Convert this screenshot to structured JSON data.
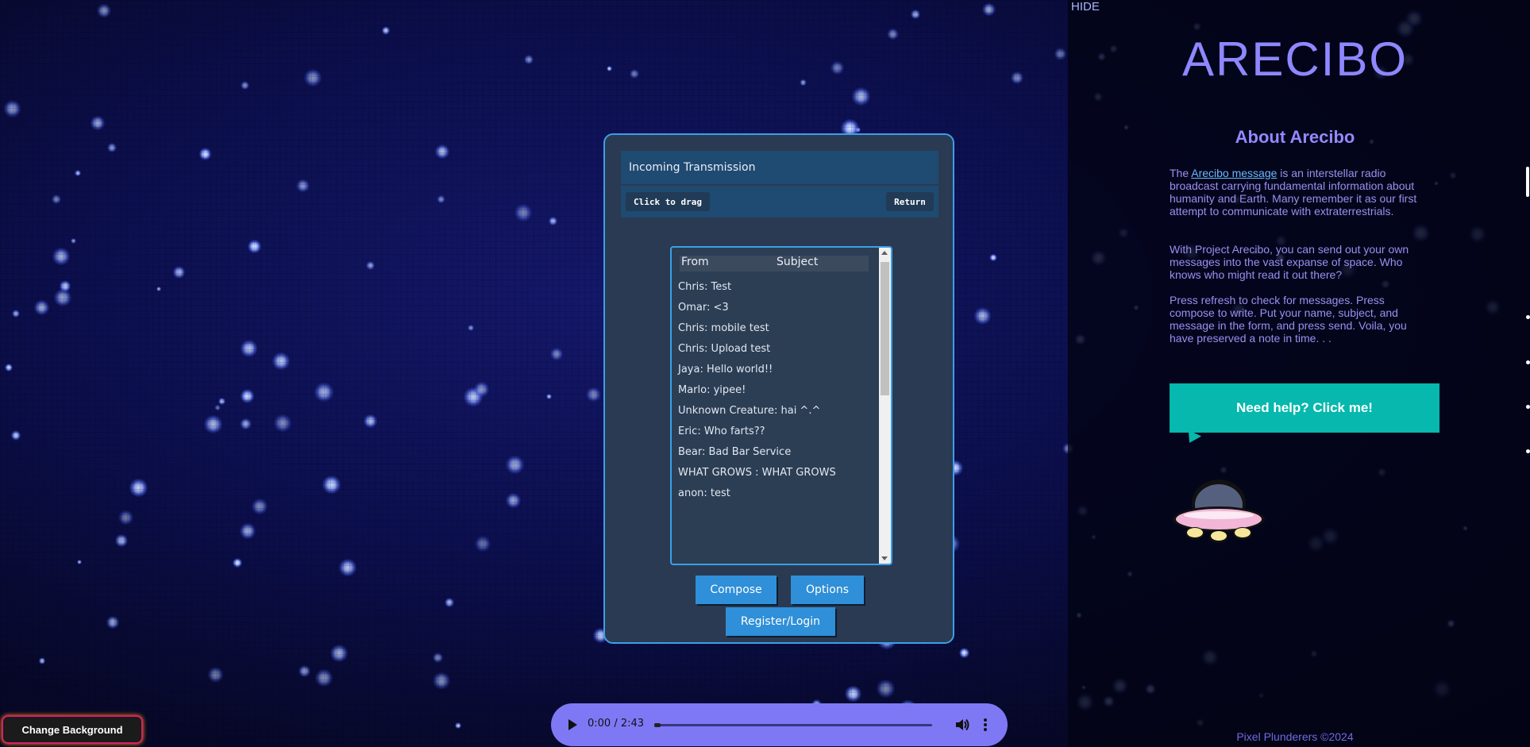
{
  "side_panel": {
    "hide_label": "HIDE",
    "site_title": "ARECIBO",
    "about_title": "About Arecibo",
    "paragraph1": {
      "prefix": "The ",
      "link_text": "Arecibo message",
      "suffix": " is an interstellar radio broadcast carrying fundamental information about humanity and Earth. Many remember it as our first attempt to communicate with extraterrestrials."
    },
    "paragraph2": "With Project Arecibo, you can send out your own messages into the vast expanse of space. Who knows who might read it out there?",
    "paragraph3": "Press refresh to check for messages. Press compose to write. Put your name, subject, and message in the form, and press send. Voila, you have preserved a note in time. . .",
    "help_button": "Need help? Click me!",
    "footer": "Pixel Plunderers ©2024"
  },
  "window": {
    "title": "Incoming Transmission",
    "drag_label": "Click to drag",
    "return_label": "Return",
    "inbox": {
      "col_from": "From",
      "col_subject": "Subject",
      "messages": [
        "Chris: Test",
        "Omar: <3",
        "Chris: mobile test",
        "Chris: Upload test",
        "Jaya: Hello world!!",
        "Marlo: yipee!",
        "Unknown Creature: hai ^.^",
        "Eric: Who farts??",
        "Bear: Bad Bar Service",
        "WHAT GROWS : WHAT GROWS",
        "anon: test"
      ]
    },
    "compose_label": "Compose",
    "options_label": "Options",
    "register_label": "Register/Login"
  },
  "audio": {
    "time": "0:00 / 2:43",
    "progress": 0
  },
  "change_background_label": "Change Background",
  "colors": {
    "accent": "#3aa0e8",
    "help": "#06b8ad",
    "title": "#8e87ff",
    "player": "#7f78f5"
  },
  "icons": [
    "play-icon",
    "volume-icon",
    "more-vert-icon",
    "ufo-icon"
  ]
}
